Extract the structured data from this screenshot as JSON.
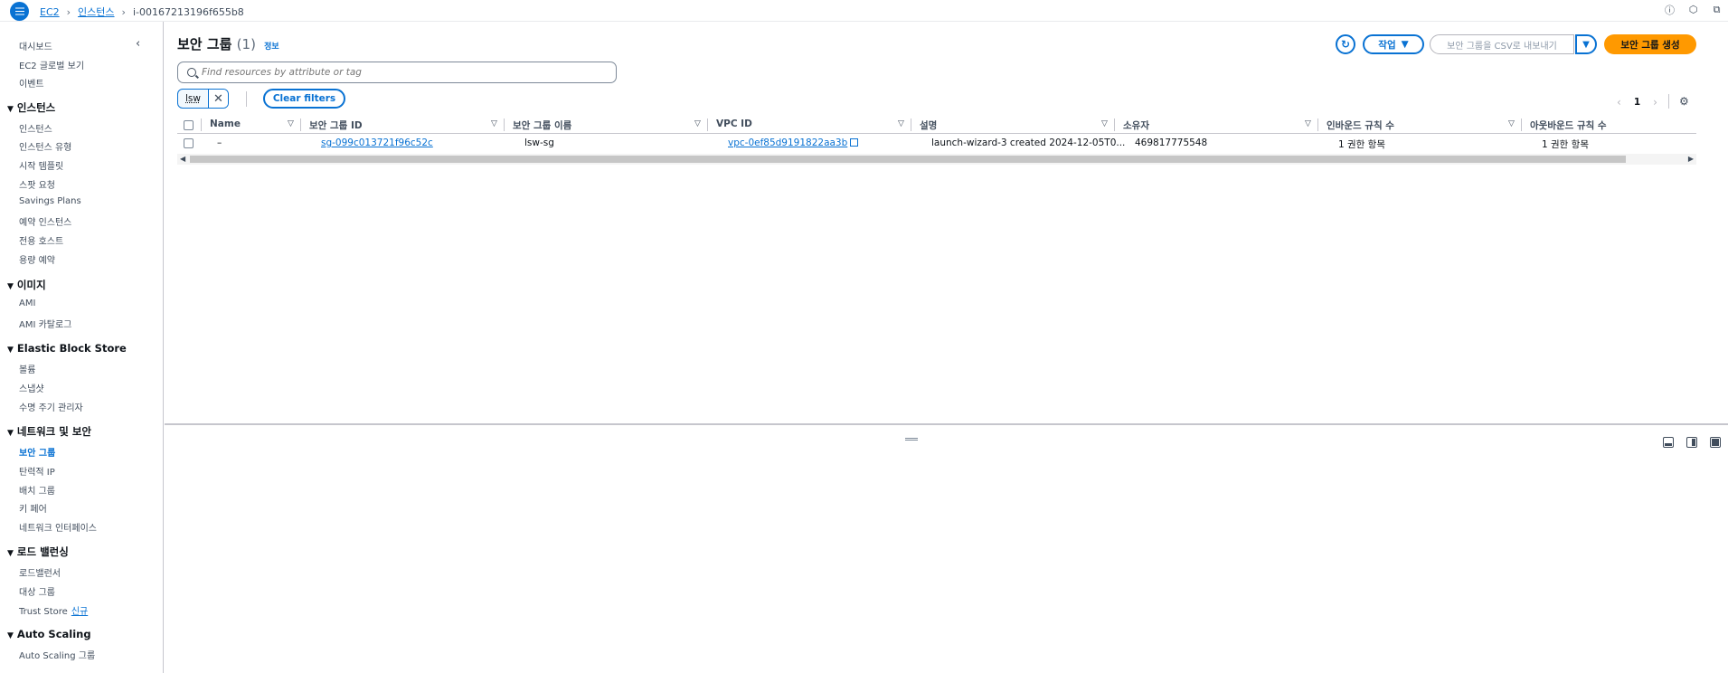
{
  "breadcrumb": {
    "items": [
      "EC2",
      "인스턴스"
    ],
    "current": "i-00167213196f655b8"
  },
  "sidebar": {
    "top_items": [
      "대시보드",
      "EC2 글로벌 보기",
      "이벤트"
    ],
    "sections": [
      {
        "title": "인스턴스",
        "items": [
          "인스턴스",
          "인스턴스 유형",
          "시작 템플릿",
          "스팟 요청",
          "Savings Plans",
          "예약 인스턴스",
          "전용 호스트",
          "용량 예약"
        ]
      },
      {
        "title": "이미지",
        "items": [
          "AMI",
          "AMI 카탈로그"
        ]
      },
      {
        "title": "Elastic Block Store",
        "items": [
          "볼륨",
          "스냅샷",
          "수명 주기 관리자"
        ]
      },
      {
        "title": "네트워크 및 보안",
        "items": [
          "보안 그룹",
          "탄력적 IP",
          "배치 그룹",
          "키 페어",
          "네트워크 인터페이스"
        ]
      },
      {
        "title": "로드 밸런싱",
        "items": [
          "로드밸런서",
          "대상 그룹",
          "Trust Store"
        ]
      },
      {
        "title": "Auto Scaling",
        "items": [
          "Auto Scaling 그룹"
        ]
      }
    ],
    "new_badge": "신규",
    "active_item": "보안 그룹"
  },
  "main": {
    "title": "보안 그룹",
    "count": "(1)",
    "info_link": "정보",
    "actions_label": "작업",
    "export_label": "보안 그룹을 CSV로 내보내기",
    "create_label": "보안 그룹 생성",
    "search_placeholder": "Find resources by attribute or tag",
    "filter_token": "lsw",
    "clear_filters_label": "Clear filters",
    "page_number": "1"
  },
  "table": {
    "columns": [
      "Name",
      "보안 그룹 ID",
      "보안 그룹 이름",
      "VPC ID",
      "설명",
      "소유자",
      "인바운드 규칙 수",
      "아웃바운드 규칙 수"
    ],
    "rows": [
      {
        "name": "–",
        "sg_id": "sg-099c013721f96c52c",
        "sg_name": "lsw-sg",
        "vpc_id": "vpc-0ef85d9191822aa3b",
        "description": "launch-wizard-3 created 2024-12-05T0...",
        "owner": "469817775548",
        "inbound": "1 권한 항목",
        "outbound": "1 권한 항목"
      }
    ]
  },
  "colors": {
    "accent": "#0972d3",
    "primary_button": "#ff9900"
  }
}
